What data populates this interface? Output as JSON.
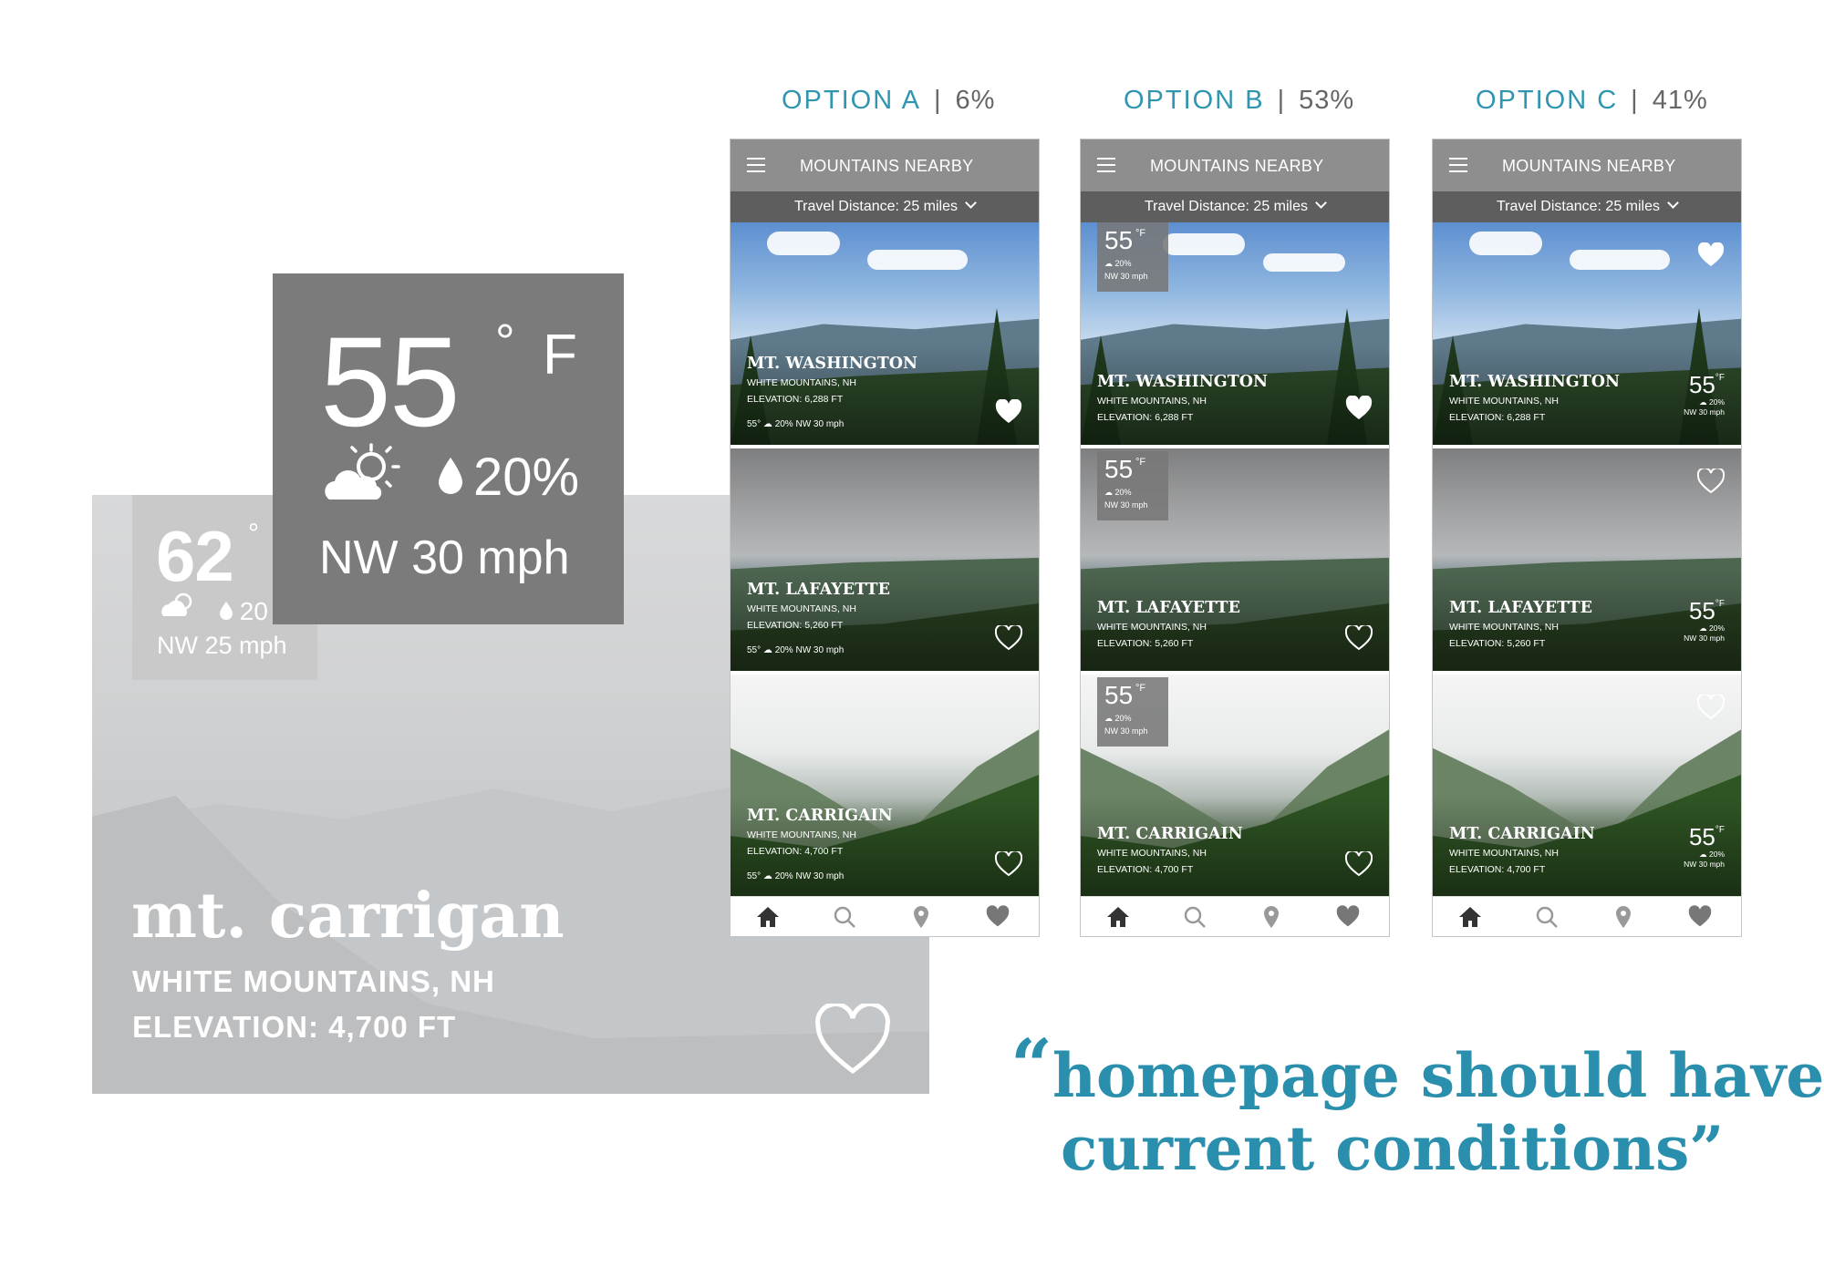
{
  "background_card": {
    "name": "mt. carrigan",
    "region": "WHITE MOUNTAINS, NH",
    "elevation": "ELEVATION: 4,700 FT",
    "small_weather": {
      "temp": "62",
      "degree": "°",
      "precip": "20",
      "wind": "NW 25 mph"
    }
  },
  "big_weather": {
    "temp": "55",
    "degree": "°",
    "unit": "F",
    "precip": "20%",
    "wind": "NW 30 mph"
  },
  "options": [
    {
      "label": "OPTION A",
      "percent": "6%"
    },
    {
      "label": "OPTION B",
      "percent": "53%"
    },
    {
      "label": "OPTION C",
      "percent": "41%"
    }
  ],
  "phone": {
    "title": "MOUNTAINS NEARBY",
    "distance": "Travel Distance: 25 miles",
    "tabs": [
      "home-icon",
      "search-icon",
      "location-pin-icon",
      "heart-icon"
    ]
  },
  "mountains": [
    {
      "name": "MT. WASHINGTON",
      "region": "WHITE MOUNTAINS, NH",
      "elevation": "ELEVATION: 6,288 FT"
    },
    {
      "name": "MT. LAFAYETTE",
      "region": "WHITE MOUNTAINS, NH",
      "elevation": "ELEVATION: 5,260 FT"
    },
    {
      "name": "MT. CARRIGAIN",
      "region": "WHITE MOUNTAINS, NH",
      "elevation": "ELEVATION: 4,700 FT"
    }
  ],
  "card_weather": {
    "temp": "55",
    "temp_inline": "55°",
    "degree": "°",
    "unit": "F",
    "precip": "20%",
    "wind": "NW 30 mph",
    "wind_small": "NW 30 mph"
  },
  "quote": {
    "line1": "homepage should have",
    "line2": "current conditions”",
    "open_mark": "“"
  },
  "colors": {
    "accent": "#2a8fad",
    "topbar": "#8e8e8e",
    "distbar": "#5e5e5e",
    "weather_box": "#7b7b7b"
  }
}
